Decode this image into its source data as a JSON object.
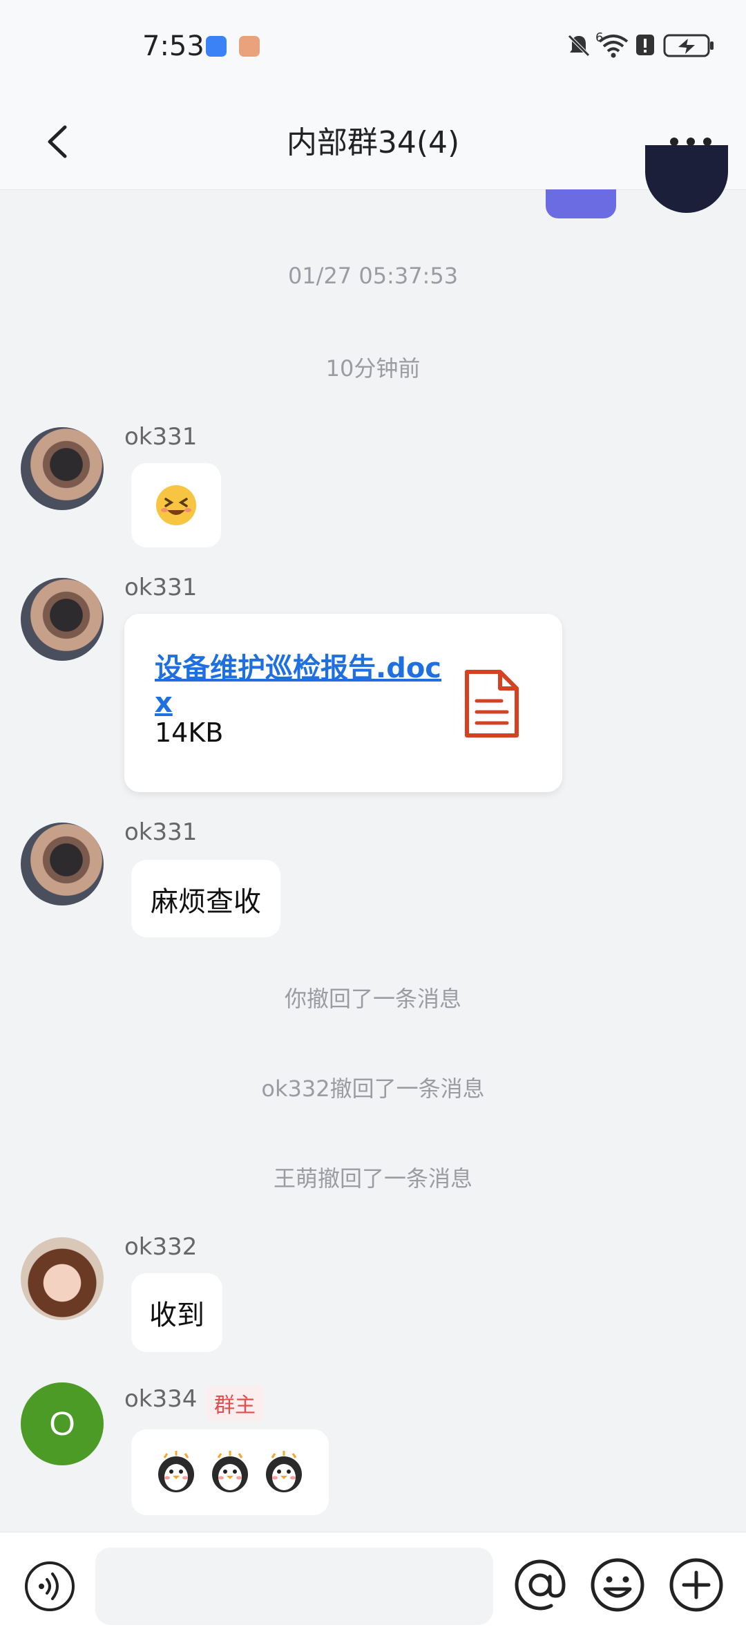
{
  "status_bar": {
    "time": "7:53",
    "signal_label": "6"
  },
  "header": {
    "title": "内部群34(4)"
  },
  "timeline": [
    {
      "type": "time",
      "text": "01/27 05:37:53"
    },
    {
      "type": "time",
      "text": "10分钟前"
    }
  ],
  "messages": [
    {
      "sender": "ok331",
      "kind": "emoji",
      "content": "grinning-squint-face"
    },
    {
      "sender": "ok331",
      "kind": "file",
      "file_name": "设备维护巡检报告.docx",
      "file_size": "14KB"
    },
    {
      "sender": "ok331",
      "kind": "text",
      "content": "麻烦查收"
    },
    {
      "sender": "ok332",
      "kind": "text",
      "content": "收到"
    },
    {
      "sender": "ok334",
      "avatar_letter": "O",
      "badge": "群主",
      "kind": "stickers",
      "content": "penguin-stickers"
    }
  ],
  "recall_notices": [
    "你撤回了一条消息",
    "ok332撤回了一条消息",
    "王萌撤回了一条消息"
  ],
  "input": {
    "placeholder": ""
  },
  "colors": {
    "accent": "#1e6fe0",
    "file_icon": "#d64122",
    "owner_badge": "#e04f4f",
    "avatar_green": "#4d9b27",
    "bubble_purple": "#6c6ce2"
  }
}
